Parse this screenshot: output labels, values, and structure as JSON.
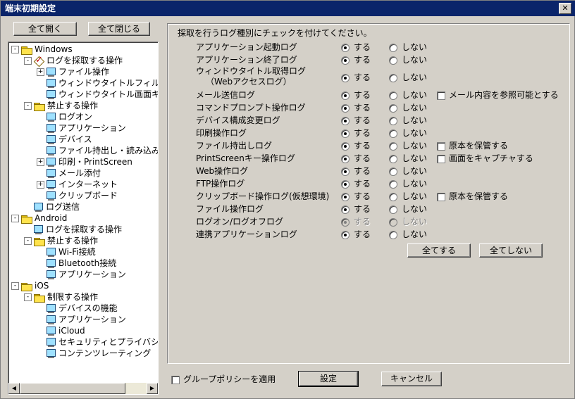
{
  "window": {
    "title": "端末初期設定",
    "close": "✕"
  },
  "left": {
    "expand_all": "全て開く",
    "collapse_all": "全て閉じる"
  },
  "tree": [
    {
      "label": "Windows",
      "icon": "folder",
      "level": 0,
      "exp": "-"
    },
    {
      "label": "ログを採取する操作",
      "icon": "check",
      "level": 1,
      "exp": "-"
    },
    {
      "label": "ファイル操作",
      "icon": "monitor",
      "level": 2,
      "exp": "+"
    },
    {
      "label": "ウィンドウタイトルフィルタ",
      "icon": "monitor",
      "level": 2,
      "exp": ""
    },
    {
      "label": "ウィンドウタイトル画面キャ",
      "icon": "monitor",
      "level": 2,
      "exp": ""
    },
    {
      "label": "禁止する操作",
      "icon": "folder",
      "level": 1,
      "exp": "-"
    },
    {
      "label": "ログオン",
      "icon": "monitor",
      "level": 2,
      "exp": ""
    },
    {
      "label": "アプリケーション",
      "icon": "monitor",
      "level": 2,
      "exp": ""
    },
    {
      "label": "デバイス",
      "icon": "monitor",
      "level": 2,
      "exp": ""
    },
    {
      "label": "ファイル持出し・読み込み",
      "icon": "monitor",
      "level": 2,
      "exp": ""
    },
    {
      "label": "印刷・PrintScreen",
      "icon": "monitor",
      "level": 2,
      "exp": "+"
    },
    {
      "label": "メール添付",
      "icon": "monitor",
      "level": 2,
      "exp": ""
    },
    {
      "label": "インターネット",
      "icon": "monitor",
      "level": 2,
      "exp": "+"
    },
    {
      "label": "クリップボード",
      "icon": "monitor",
      "level": 2,
      "exp": ""
    },
    {
      "label": "ログ送信",
      "icon": "monitor",
      "level": 1,
      "exp": ""
    },
    {
      "label": "Android",
      "icon": "folder",
      "level": 0,
      "exp": "-"
    },
    {
      "label": "ログを採取する操作",
      "icon": "monitor",
      "level": 1,
      "exp": ""
    },
    {
      "label": "禁止する操作",
      "icon": "folder",
      "level": 1,
      "exp": "-"
    },
    {
      "label": "Wi-Fi接続",
      "icon": "monitor",
      "level": 2,
      "exp": ""
    },
    {
      "label": "Bluetooth接続",
      "icon": "monitor",
      "level": 2,
      "exp": ""
    },
    {
      "label": "アプリケーション",
      "icon": "monitor",
      "level": 2,
      "exp": ""
    },
    {
      "label": "iOS",
      "icon": "folder",
      "level": 0,
      "exp": "-"
    },
    {
      "label": "制限する操作",
      "icon": "folder",
      "level": 1,
      "exp": "-"
    },
    {
      "label": "デバイスの機能",
      "icon": "monitor",
      "level": 2,
      "exp": ""
    },
    {
      "label": "アプリケーション",
      "icon": "monitor",
      "level": 2,
      "exp": ""
    },
    {
      "label": "iCloud",
      "icon": "monitor",
      "level": 2,
      "exp": ""
    },
    {
      "label": "セキュリティとプライバシー",
      "icon": "monitor",
      "level": 2,
      "exp": ""
    },
    {
      "label": "コンテンツレーティング",
      "icon": "monitor",
      "level": 2,
      "exp": ""
    }
  ],
  "main": {
    "instruction": "採取を行うログ種別にチェックを付けてください。",
    "yes": "する",
    "no": "しない",
    "rows": [
      {
        "label": "アプリケーション起動ログ",
        "value": "yes"
      },
      {
        "label": "アプリケーション終了ログ",
        "value": "yes"
      },
      {
        "label": "ウィンドウタイトル取得ログ",
        "label2": "（Webアクセスログ）",
        "value": "yes"
      },
      {
        "label": "メール送信ログ",
        "value": "yes",
        "extra": "メール内容を参照可能とする"
      },
      {
        "label": "コマンドプロンプト操作ログ",
        "value": "yes"
      },
      {
        "label": "デバイス構成変更ログ",
        "value": "yes"
      },
      {
        "label": "印刷操作ログ",
        "value": "yes"
      },
      {
        "label": "ファイル持出しログ",
        "value": "yes",
        "extra": "原本を保管する"
      },
      {
        "label": "PrintScreenキー操作ログ",
        "value": "yes",
        "extra": "画面をキャプチャする"
      },
      {
        "label": "Web操作ログ",
        "value": "yes"
      },
      {
        "label": "FTP操作ログ",
        "value": "yes"
      },
      {
        "label": "クリップボード操作ログ(仮想環境)",
        "value": "yes",
        "extra": "原本を保管する"
      },
      {
        "label": "ファイル操作ログ",
        "value": "yes"
      },
      {
        "label": "ログオン/ログオフログ",
        "value": "yes",
        "disabled": true
      },
      {
        "label": "連携アプリケーションログ",
        "value": "yes"
      }
    ],
    "all_yes": "全てする",
    "all_no": "全てしない"
  },
  "footer": {
    "group_policy": "グループポリシーを適用",
    "apply": "設定",
    "cancel": "キャンセル"
  }
}
